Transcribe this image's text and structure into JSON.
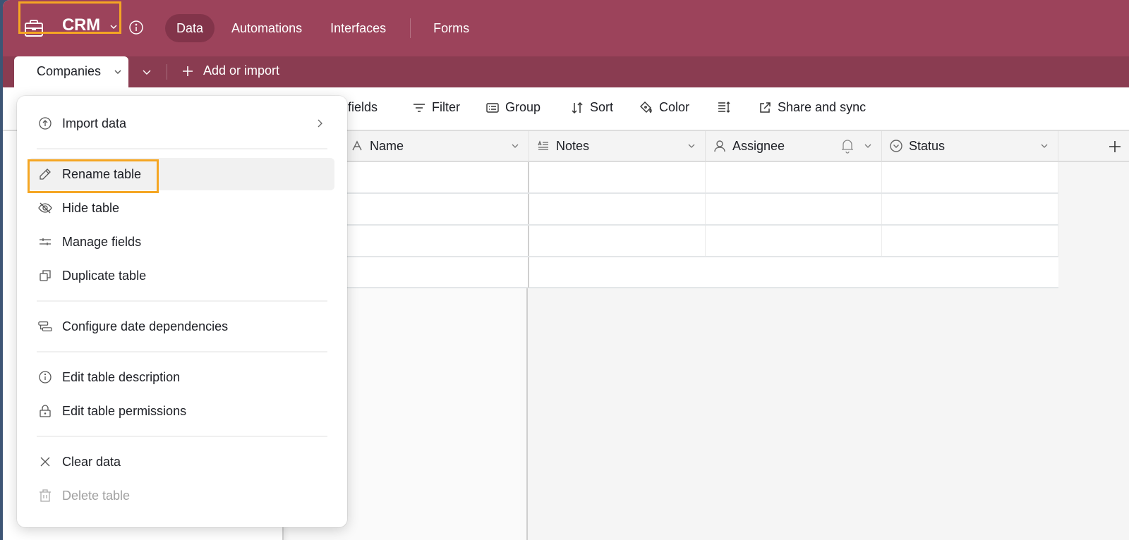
{
  "app": {
    "title": "CRM",
    "icon": "briefcase-icon",
    "nav": [
      {
        "label": "Data",
        "active": true
      },
      {
        "label": "Automations",
        "active": false
      },
      {
        "label": "Interfaces",
        "active": false
      },
      {
        "label": "Forms",
        "active": false
      }
    ],
    "colors": {
      "brand": "#9c435b",
      "tabbar": "#8a3c51",
      "nav_active": "#82344a",
      "highlight": "#f5a623"
    }
  },
  "tabs": {
    "active_table": "Companies",
    "add_label": "Add or import"
  },
  "toolbar": {
    "hide_fields": "e fields",
    "filter": "Filter",
    "group": "Group",
    "sort": "Sort",
    "color": "Color",
    "row_height_icon": "row-height-icon",
    "share": "Share and sync"
  },
  "grid": {
    "columns": [
      {
        "label": "Name",
        "icon": "text-icon"
      },
      {
        "label": "Notes",
        "icon": "long-text-icon"
      },
      {
        "label": "Assignee",
        "icon": "user-icon"
      },
      {
        "label": "Status",
        "icon": "single-select-icon"
      }
    ],
    "rows": [
      [
        "",
        "",
        "",
        ""
      ],
      [
        "",
        "",
        "",
        ""
      ],
      [
        "",
        "",
        "",
        ""
      ]
    ]
  },
  "menu": {
    "items": [
      {
        "label": "Import data",
        "icon": "upload-circle-icon",
        "submenu": true
      },
      {
        "label": "Rename table",
        "icon": "pencil-icon",
        "hover": true
      },
      {
        "label": "Hide table",
        "icon": "eye-slash-icon"
      },
      {
        "label": "Manage fields",
        "icon": "sliders-icon"
      },
      {
        "label": "Duplicate table",
        "icon": "duplicate-icon"
      },
      {
        "label": "Configure date dependencies",
        "icon": "dependencies-icon"
      },
      {
        "label": "Edit table description",
        "icon": "info-icon"
      },
      {
        "label": "Edit table permissions",
        "icon": "lock-icon"
      },
      {
        "label": "Clear data",
        "icon": "x-icon"
      },
      {
        "label": "Delete table",
        "icon": "trash-icon",
        "disabled": true
      }
    ]
  }
}
